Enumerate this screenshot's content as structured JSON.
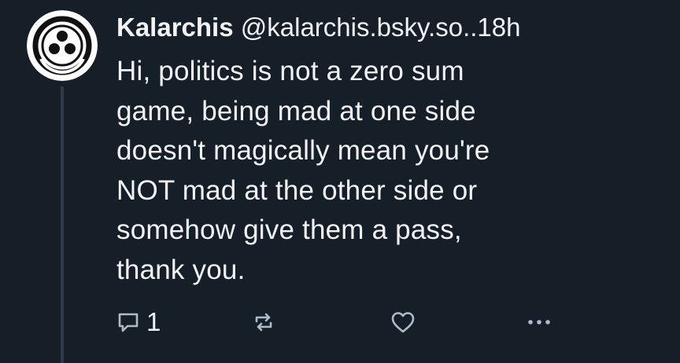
{
  "post": {
    "author": {
      "display_name": "Kalarchis",
      "handle": "@kalarchis.bsky.so..",
      "timestamp": "18h",
      "avatar_icon": "three-dots-circle-avatar"
    },
    "text_lines": [
      "Hi, politics is not a zero sum",
      "game, being mad at one side",
      "doesn't magically mean you're",
      "NOT mad at the other side or",
      "somehow give them a pass,",
      "thank you."
    ],
    "actions": {
      "reply_icon": "reply-bubble-icon",
      "reply_count": "1",
      "repost_icon": "repost-icon",
      "like_icon": "heart-icon",
      "more_icon": "ellipsis-icon"
    }
  },
  "colors": {
    "background": "#161e27",
    "text": "#f1f3f5",
    "muted_icon": "#aebbc9",
    "thread_line": "#2e3a48"
  }
}
